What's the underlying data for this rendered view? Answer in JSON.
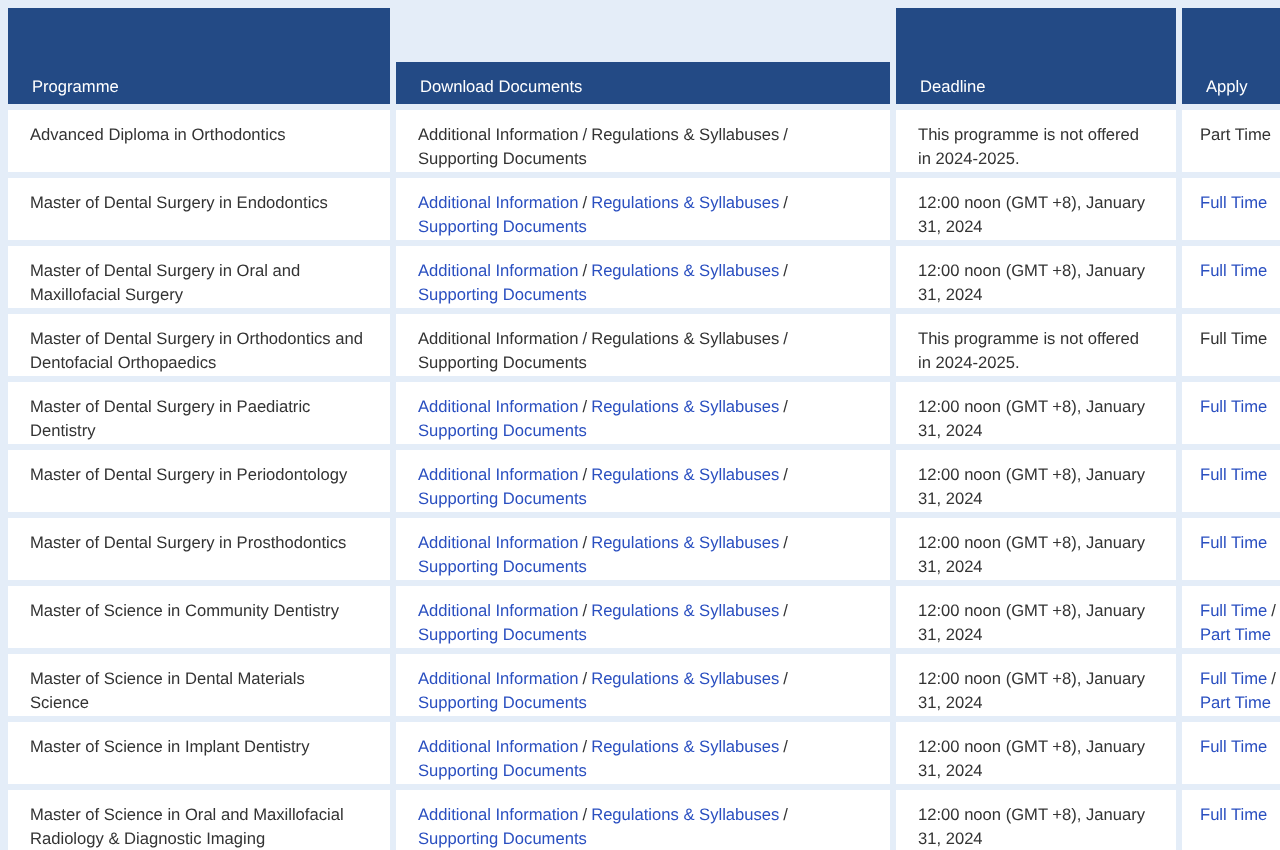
{
  "table": {
    "columns": [
      "Programme",
      "Download Documents",
      "Deadline",
      "Apply"
    ],
    "separator": "/",
    "rows": [
      {
        "programme": "Advanced Diploma in Orthodontics",
        "documents": {
          "linked": false,
          "items": [
            "Additional Information",
            "Regulations & Syllabuses",
            "Supporting Documents"
          ]
        },
        "deadline": "This programme is not offered in 2024-2025.",
        "apply": {
          "linked": false,
          "items": [
            "Part Time"
          ]
        }
      },
      {
        "programme": "Master of Dental Surgery in Endodontics",
        "documents": {
          "linked": true,
          "items": [
            "Additional Information",
            "Regulations & Syllabuses",
            "Supporting Documents"
          ]
        },
        "deadline": "12:00 noon (GMT +8), January 31, 2024",
        "apply": {
          "linked": true,
          "items": [
            "Full Time"
          ]
        }
      },
      {
        "programme": "Master of Dental Surgery in Oral and Maxillofacial Surgery",
        "documents": {
          "linked": true,
          "items": [
            "Additional Information",
            "Regulations & Syllabuses",
            "Supporting Documents"
          ]
        },
        "deadline": "12:00 noon (GMT +8), January 31, 2024",
        "apply": {
          "linked": true,
          "items": [
            "Full Time"
          ]
        }
      },
      {
        "programme": "Master of Dental Surgery in Orthodontics and Dentofacial Orthopaedics",
        "documents": {
          "linked": false,
          "items": [
            "Additional Information",
            "Regulations & Syllabuses",
            "Supporting Documents"
          ]
        },
        "deadline": "This programme is not offered in 2024-2025.",
        "apply": {
          "linked": false,
          "items": [
            "Full Time"
          ]
        }
      },
      {
        "programme": "Master of Dental Surgery in Paediatric Dentistry",
        "documents": {
          "linked": true,
          "items": [
            "Additional Information",
            "Regulations & Syllabuses",
            "Supporting Documents"
          ]
        },
        "deadline": "12:00 noon (GMT +8), January 31, 2024",
        "apply": {
          "linked": true,
          "items": [
            "Full Time"
          ]
        }
      },
      {
        "programme": "Master of Dental Surgery in Periodontology",
        "documents": {
          "linked": true,
          "items": [
            "Additional Information",
            "Regulations & Syllabuses",
            "Supporting Documents"
          ]
        },
        "deadline": "12:00 noon (GMT +8), January 31, 2024",
        "apply": {
          "linked": true,
          "items": [
            "Full Time"
          ]
        }
      },
      {
        "programme": "Master of Dental Surgery in Prosthodontics",
        "documents": {
          "linked": true,
          "items": [
            "Additional Information",
            "Regulations & Syllabuses",
            "Supporting Documents"
          ]
        },
        "deadline": "12:00 noon (GMT +8), January 31, 2024",
        "apply": {
          "linked": true,
          "items": [
            "Full Time"
          ]
        }
      },
      {
        "programme": "Master of Science in Community Dentistry",
        "documents": {
          "linked": true,
          "items": [
            "Additional Information",
            "Regulations & Syllabuses",
            "Supporting Documents"
          ]
        },
        "deadline": "12:00 noon (GMT +8), January 31, 2024",
        "apply": {
          "linked": true,
          "items": [
            "Full Time",
            "Part Time"
          ]
        }
      },
      {
        "programme": "Master of Science in Dental Materials Science",
        "documents": {
          "linked": true,
          "items": [
            "Additional Information",
            "Regulations & Syllabuses",
            "Supporting Documents"
          ]
        },
        "deadline": "12:00 noon (GMT +8), January 31, 2024",
        "apply": {
          "linked": true,
          "items": [
            "Full Time",
            "Part Time"
          ]
        }
      },
      {
        "programme": "Master of Science in Implant Dentistry",
        "documents": {
          "linked": true,
          "items": [
            "Additional Information",
            "Regulations & Syllabuses",
            "Supporting Documents"
          ]
        },
        "deadline": "12:00 noon (GMT +8), January 31, 2024",
        "apply": {
          "linked": true,
          "items": [
            "Full Time"
          ]
        }
      },
      {
        "programme": "Master of Science in Oral and Maxillofacial Radiology & Diagnostic Imaging",
        "documents": {
          "linked": true,
          "items": [
            "Additional Information",
            "Regulations & Syllabuses",
            "Supporting Documents"
          ]
        },
        "deadline": "12:00 noon (GMT +8), January 31, 2024",
        "apply": {
          "linked": true,
          "items": [
            "Full Time"
          ]
        }
      }
    ]
  }
}
